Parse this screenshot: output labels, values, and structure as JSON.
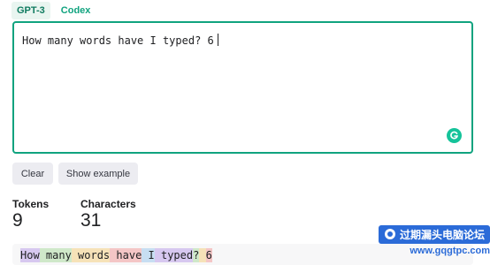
{
  "tabs": [
    {
      "label": "GPT-3",
      "active": true
    },
    {
      "label": "Codex",
      "active": false
    }
  ],
  "editor": {
    "text": "How many words have I typed? 6"
  },
  "buttons": {
    "clear": "Clear",
    "show_example": "Show example"
  },
  "stats": {
    "tokens_label": "Tokens",
    "tokens_value": "9",
    "characters_label": "Characters",
    "characters_value": "31"
  },
  "token_view": {
    "tokens": [
      {
        "text": "How",
        "color": "#d7c8f0"
      },
      {
        "text": " many",
        "color": "#cfe8c9"
      },
      {
        "text": " words",
        "color": "#f6e2b8"
      },
      {
        "text": " have",
        "color": "#f4c6c6"
      },
      {
        "text": " I",
        "color": "#c7def2"
      },
      {
        "text": " typed",
        "color": "#d7c8f0"
      },
      {
        "text": "?",
        "color": "#cfe8c9"
      },
      {
        "text": " ",
        "color": "#f6e2b8"
      },
      {
        "text": "6",
        "color": "#f4c6c6"
      }
    ]
  },
  "watermark": {
    "top": "过期漏头电脑论坛",
    "bottom": "www.gqgtpc.com"
  },
  "colors": {
    "accent": "#10a37f",
    "button_bg": "#ececf1"
  }
}
